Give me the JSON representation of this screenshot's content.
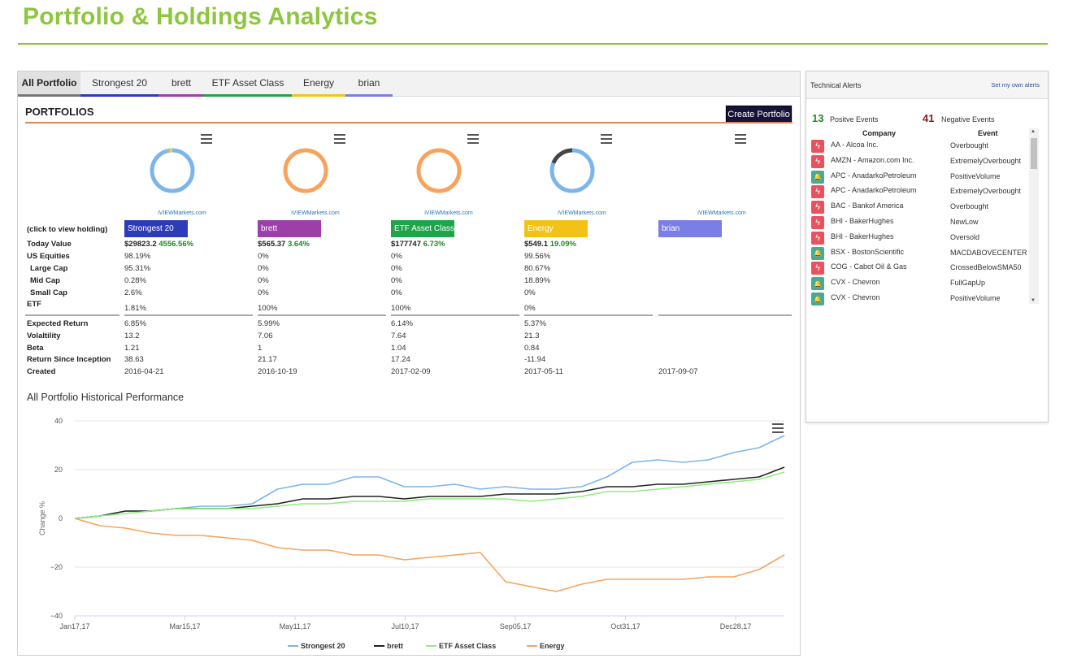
{
  "page": {
    "title": "Portfolio & Holdings Analytics"
  },
  "tabs": [
    {
      "label": "All Portfolio",
      "color": "#777777",
      "active": true
    },
    {
      "label": "Strongest 20",
      "color": "#2e3bb8"
    },
    {
      "label": "brett",
      "color": "#9c3fa8"
    },
    {
      "label": "ETF Asset Class",
      "color": "#1ea44a"
    },
    {
      "label": "Energy",
      "color": "#f2c316"
    },
    {
      "label": "brian",
      "color": "#7b7ee6"
    }
  ],
  "portfolios_section": {
    "heading": "PORTFOLIOS",
    "create_button": "Create Portfolio",
    "credit": "iVIEWMarkets.com",
    "click_label": "(click to view holding)",
    "row_labels": {
      "today_value": "Today Value",
      "us_equities": "US Equities",
      "large_cap": "Large Cap",
      "mid_cap": "Mid Cap",
      "small_cap": "Small Cap",
      "etf": "ETF",
      "expected_return": "Expected Return",
      "volatility": "Volaltility",
      "beta": "Beta",
      "return_since_inception": "Return Since Inception",
      "created": "Created"
    },
    "portfolios": [
      {
        "name": "Strongest 20",
        "color": "#2e3bb8",
        "value": "$29823.2",
        "change": "4556.56%",
        "us_equities": "98.19%",
        "large_cap": "95.31%",
        "mid_cap": "0.28%",
        "small_cap": "2.6%",
        "etf": "1.81%",
        "expected_return": "6.85%",
        "volatility": "13.2",
        "beta": "1.21",
        "return_since_inception": "38.63",
        "created": "2016-04-21"
      },
      {
        "name": "brett",
        "color": "#9c3fa8",
        "value": "$565.37",
        "change": "3.64%",
        "us_equities": "0%",
        "large_cap": "0%",
        "mid_cap": "0%",
        "small_cap": "0%",
        "etf": "100%",
        "expected_return": "5.99%",
        "volatility": "7.06",
        "beta": "1",
        "return_since_inception": "21.17",
        "created": "2016-10-19"
      },
      {
        "name": "ETF Asset Class",
        "color": "#1ea44a",
        "value": "$177747",
        "change": "6.73%",
        "us_equities": "0%",
        "large_cap": "0%",
        "mid_cap": "0%",
        "small_cap": "0%",
        "etf": "100%",
        "expected_return": "6.14%",
        "volatility": "7.64",
        "beta": "1.04",
        "return_since_inception": "17.24",
        "created": "2017-02-09"
      },
      {
        "name": "Energy",
        "color": "#f2c316",
        "value": "$549.1",
        "change": "19.09%",
        "us_equities": "99.56%",
        "large_cap": "80.67%",
        "mid_cap": "18.89%",
        "small_cap": "0%",
        "etf": "0%",
        "expected_return": "5.37%",
        "volatility": "21.3",
        "beta": "0.84",
        "return_since_inception": "-11.94",
        "created": "2017-05-11"
      },
      {
        "name": "brian",
        "color": "#7b7ee6",
        "value": "",
        "change": "",
        "us_equities": "",
        "large_cap": "",
        "mid_cap": "",
        "small_cap": "",
        "etf": "",
        "expected_return": "",
        "volatility": "",
        "beta": "",
        "return_since_inception": "",
        "created": "2017-09-07"
      }
    ],
    "donuts": [
      {
        "segments": [
          {
            "value": 96,
            "color": "#7cb5ec"
          },
          {
            "value": 2,
            "color": "#f7a35c"
          },
          {
            "value": 1,
            "color": "#90ed7d"
          },
          {
            "value": 1,
            "color": "#e4d354"
          }
        ]
      },
      {
        "segments": [
          {
            "value": 100,
            "color": "#f7a35c"
          }
        ]
      },
      {
        "segments": [
          {
            "value": 100,
            "color": "#f7a35c"
          }
        ]
      },
      {
        "segments": [
          {
            "value": 81,
            "color": "#7cb5ec"
          },
          {
            "value": 19,
            "color": "#434348"
          }
        ]
      },
      {
        "segments": []
      }
    ]
  },
  "chart_data": {
    "type": "line",
    "title": "All Portfolio Historical Performance",
    "ylabel": "Change %",
    "ylim": [
      -40,
      40
    ],
    "yticks": [
      "40",
      "20",
      "0",
      "−20",
      "−40"
    ],
    "xticks": [
      "Jan17,17",
      "Mar15,17",
      "May11,17",
      "Jul10,17",
      "Sep05,17",
      "Oct31,17",
      "Dec28,17"
    ],
    "x": [
      "Jan17",
      "Feb1",
      "Feb15",
      "Mar1",
      "Mar15",
      "Apr1",
      "Apr15",
      "May1",
      "May11",
      "May20",
      "Jun1",
      "Jun15",
      "Jul1",
      "Jul10",
      "Jul20",
      "Aug1",
      "Aug10",
      "Aug15",
      "Aug25",
      "Sep5",
      "Sep20",
      "Oct1",
      "Oct15",
      "Oct31",
      "Nov15",
      "Dec1",
      "Dec15",
      "Dec28",
      "Jan5"
    ],
    "series": [
      {
        "name": "Strongest 20",
        "color": "#7cb5ec",
        "values": [
          0,
          1,
          3,
          3,
          4,
          5,
          5,
          6,
          12,
          14,
          14,
          17,
          17,
          13,
          13,
          14,
          12,
          13,
          12,
          12,
          13,
          17,
          23,
          24,
          23,
          24,
          27,
          29,
          34
        ]
      },
      {
        "name": "brett",
        "color": "#222222",
        "values": [
          0,
          1,
          3,
          3,
          4,
          4,
          4,
          5,
          6,
          8,
          8,
          9,
          9,
          8,
          9,
          9,
          9,
          10,
          10,
          10,
          11,
          13,
          13,
          14,
          14,
          15,
          16,
          17,
          21
        ]
      },
      {
        "name": "ETF Asset Class",
        "color": "#90ed7d",
        "values": [
          0,
          1,
          2,
          3,
          4,
          4,
          4,
          4,
          5,
          6,
          6,
          7,
          7,
          7,
          8,
          8,
          8,
          8,
          7,
          8,
          9,
          11,
          11,
          12,
          13,
          14,
          15,
          16,
          19
        ]
      },
      {
        "name": "Energy",
        "color": "#f7a35c",
        "values": [
          0,
          -3,
          -4,
          -6,
          -7,
          -7,
          -8,
          -9,
          -12,
          -13,
          -13,
          -15,
          -15,
          -17,
          -16,
          -15,
          -14,
          -26,
          -28,
          -30,
          -27,
          -25,
          -25,
          -25,
          -25,
          -24,
          -24,
          -21,
          -15
        ]
      }
    ]
  },
  "alerts": {
    "title": "Technical Alerts",
    "link": "Set my own alerts",
    "positive_count": "13",
    "positive_label": "Positve Events",
    "negative_count": "41",
    "negative_label": "Negative Events",
    "col_company": "Company",
    "col_event": "Event",
    "positive_color": "#4aa995",
    "negative_color": "#e8515d",
    "rows": [
      {
        "company": "AA - Alcoa Inc.",
        "event": "Overbought",
        "type": "negative"
      },
      {
        "company": "AMZN - Amazon.com Inc.",
        "event": "ExtremelyOverbought",
        "type": "negative"
      },
      {
        "company": "APC - AnadarkoPetroleum",
        "event": "PositiveVolume",
        "type": "positive"
      },
      {
        "company": "APC - AnadarkoPetroleum",
        "event": "ExtremelyOverbought",
        "type": "negative"
      },
      {
        "company": "BAC - Bankof America",
        "event": "Overbought",
        "type": "negative"
      },
      {
        "company": "BHI - BakerHughes",
        "event": "NewLow",
        "type": "negative"
      },
      {
        "company": "BHI - BakerHughes",
        "event": "Oversold",
        "type": "negative"
      },
      {
        "company": "BSX - BostonScientific",
        "event": "MACDABOVECENTER",
        "type": "positive"
      },
      {
        "company": "COG - Cabot Oil & Gas",
        "event": "CrossedBelowSMA50",
        "type": "negative"
      },
      {
        "company": "CVX - Chevron",
        "event": "FullGapUp",
        "type": "positive"
      },
      {
        "company": "CVX - Chevron",
        "event": "PositiveVolume",
        "type": "positive"
      }
    ]
  }
}
